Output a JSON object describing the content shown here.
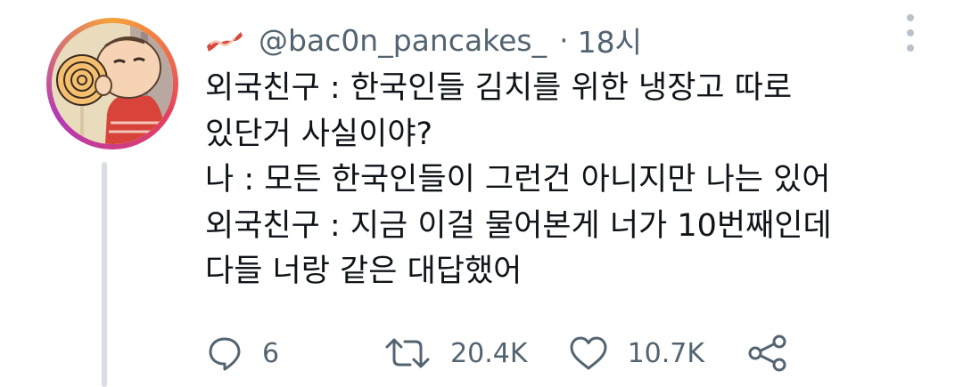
{
  "tweet": {
    "handle": "@bac0n_pancakes_",
    "separator": "·",
    "time": "18시",
    "lines": [
      "외국친구 : 한국인들 김치를 위한 냉장고 따로",
      "있단거 사실이야?",
      "나 : 모든 한국인들이 그런건 아니지만 나는 있어",
      "외국친구 : 지금 이걸 물어본게 너가 10번째인데",
      "다들 너랑 같은 대답했어"
    ]
  },
  "actions": {
    "reply_count": "6",
    "retweet_count": "20.4K",
    "like_count": "10.7K"
  },
  "icons": {
    "header": "bacon-icon",
    "menu": "vertical-ellipsis-icon",
    "reply": "speech-bubble-icon",
    "retweet": "retweet-arrows-icon",
    "like": "heart-icon",
    "share": "share-nodes-icon"
  },
  "colors": {
    "text": "#0f1419",
    "secondary": "#536471",
    "thread_line": "#d8dde1",
    "avatar_ring": "#e4405f"
  }
}
